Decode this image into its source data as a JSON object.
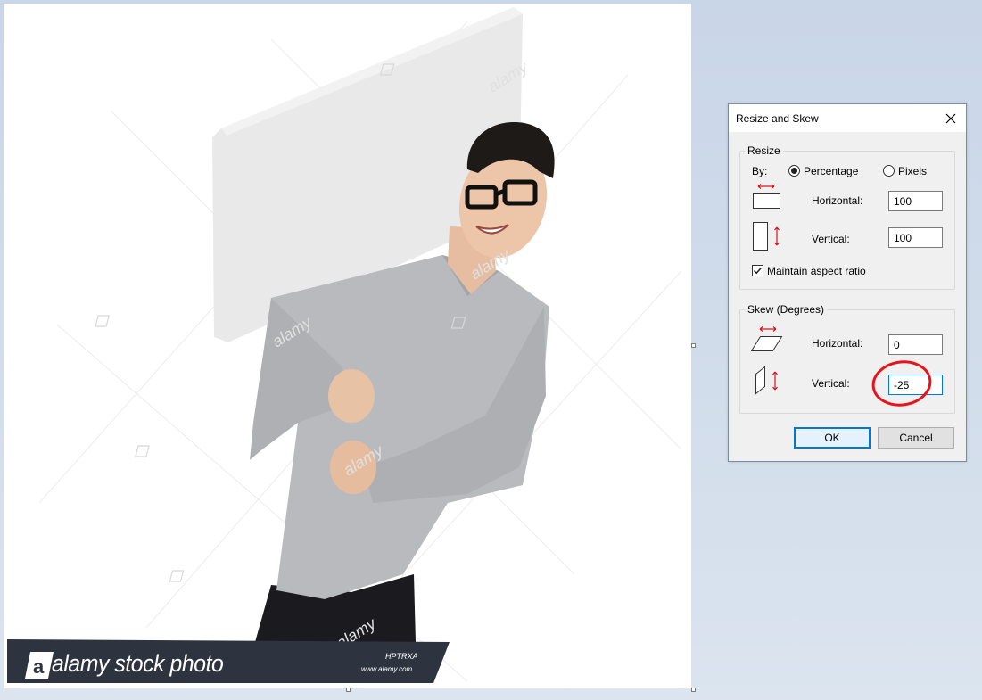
{
  "banner": {
    "logo_letter": "a",
    "brand_text": "alamy stock photo",
    "image_code": "HPTRXA",
    "url": "www.alamy.com",
    "watermark": "alamy"
  },
  "dialog": {
    "title": "Resize and Skew",
    "resize": {
      "group_label": "Resize",
      "by_label": "By:",
      "percentage_label": "Percentage",
      "pixels_label": "Pixels",
      "selected_mode": "Percentage",
      "horizontal_label": "Horizontal:",
      "horizontal_value": "100",
      "vertical_label": "Vertical:",
      "vertical_value": "100",
      "maintain_aspect_label": "Maintain aspect ratio",
      "maintain_aspect_checked": true
    },
    "skew": {
      "group_label": "Skew (Degrees)",
      "horizontal_label": "Horizontal:",
      "horizontal_value": "0",
      "vertical_label": "Vertical:",
      "vertical_value": "-25"
    },
    "ok_label": "OK",
    "cancel_label": "Cancel"
  },
  "colors": {
    "accent": "#0078d7",
    "annotation_circle": "#e8141b",
    "arrow_red": "#d9161c",
    "banner_bg": "#2e3340"
  }
}
